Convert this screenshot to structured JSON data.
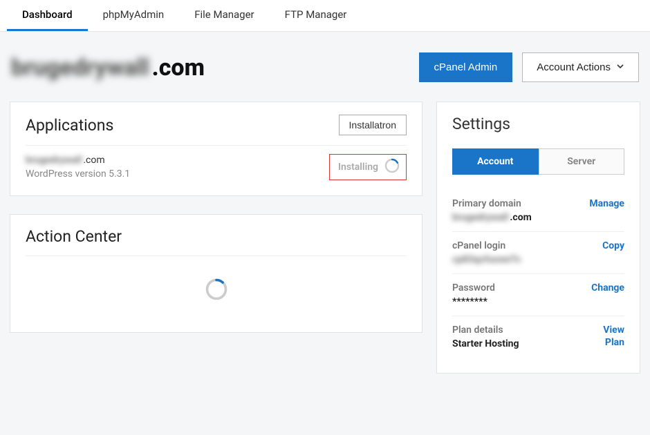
{
  "tabs": [
    "Dashboard",
    "phpMyAdmin",
    "File Manager",
    "FTP Manager"
  ],
  "domain": {
    "hidden_part": "brugedrywall",
    "visible_suffix": ".com"
  },
  "header_actions": {
    "cpanel_admin": "cPanel Admin",
    "account_actions": "Account Actions"
  },
  "applications": {
    "title": "Applications",
    "installatron_btn": "Installatron",
    "app_domain_hidden": "brugedrywall",
    "app_domain_suffix": ".com",
    "version_line": "WordPress version 5.3.1",
    "installing_label": "Installing"
  },
  "action_center": {
    "title": "Action Center"
  },
  "settings": {
    "title": "Settings",
    "segments": {
      "account": "Account",
      "server": "Server"
    },
    "rows": {
      "primary_domain": {
        "label": "Primary domain",
        "value_hidden": "brugedrywall",
        "value_suffix": ".com",
        "action": "Manage"
      },
      "cpanel_login": {
        "label": "cPanel login",
        "value_hidden": "cp83qcfusweTc",
        "action": "Copy"
      },
      "password": {
        "label": "Password",
        "value": "********",
        "action": "Change"
      },
      "plan_details": {
        "label": "Plan details",
        "value": "Starter Hosting",
        "action1": "View",
        "action2": "Plan"
      }
    }
  },
  "colors": {
    "accent": "#1a74c7",
    "danger": "#d63333"
  }
}
